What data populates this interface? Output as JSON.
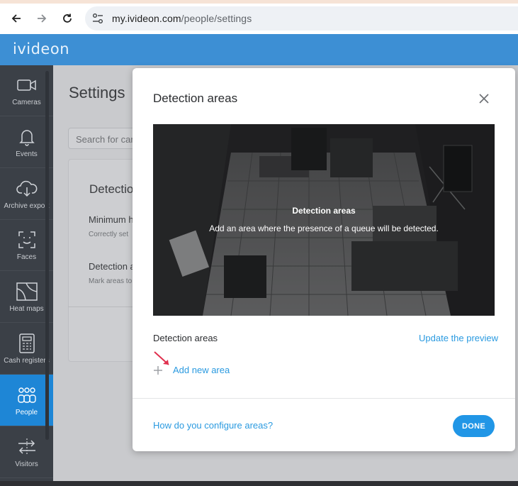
{
  "browser": {
    "url_host": "my.ivideon.com",
    "url_path": "/people/settings"
  },
  "app": {
    "logo": "ivideon"
  },
  "sidebar": {
    "items": [
      {
        "label": "Cameras",
        "icon": "camera-icon"
      },
      {
        "label": "Events",
        "icon": "bell-icon"
      },
      {
        "label": "Archive export",
        "icon": "cloud-download-icon"
      },
      {
        "label": "Faces",
        "icon": "face-scan-icon"
      },
      {
        "label": "Heat maps",
        "icon": "heat-map-icon"
      },
      {
        "label": "Cash registers",
        "icon": "cash-register-icon"
      },
      {
        "label": "People",
        "icon": "people-icon",
        "active": true
      },
      {
        "label": "Visitors",
        "icon": "visitors-icon"
      }
    ]
  },
  "page": {
    "title": "Settings",
    "search_placeholder": "Search for cam",
    "card_title": "Detectio",
    "min_label": "Minimum h",
    "min_sub": "Correctly set",
    "areas_label": "Detection a",
    "areas_sub": "Mark areas to"
  },
  "modal": {
    "title": "Detection areas",
    "overlay_title": "Detection areas",
    "overlay_text": "Add an area where the presence of a queue will be detected.",
    "areas_label": "Detection areas",
    "update_link": "Update the preview",
    "add_link": "Add new area",
    "help_link": "How do you configure areas?",
    "done_label": "DONE"
  },
  "colors": {
    "header": "#3d8fd4",
    "sidebar": "#3b4047",
    "active": "#1e86d6",
    "link": "#2a9ae0",
    "button": "#2196e6",
    "annotation_arrow": "#e0304e"
  }
}
